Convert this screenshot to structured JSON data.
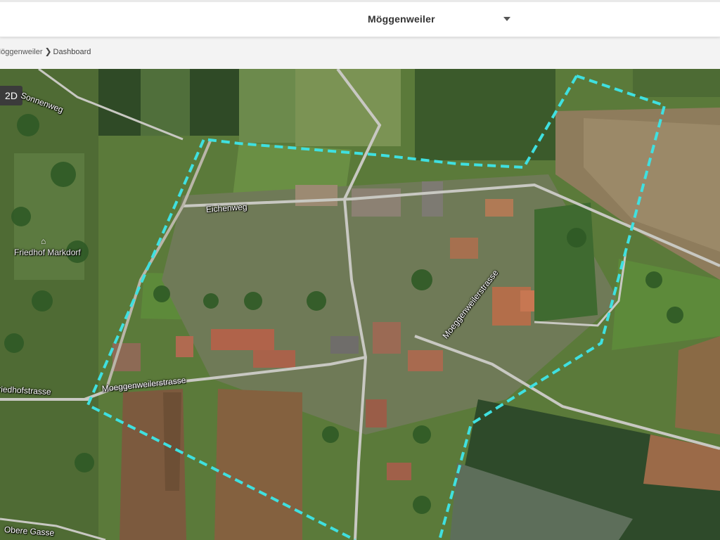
{
  "header": {
    "location_selector": {
      "value": "Möggenweiler"
    }
  },
  "breadcrumb": {
    "items": [
      "Möggenweiler",
      "Dashboard"
    ],
    "separator": "❯"
  },
  "map": {
    "view_toggle_label": "2D",
    "boundary_color": "#3fe0e0",
    "labels": {
      "eichenweg": "Eichenweg",
      "moeggenweilerstrasse": "Moeggenweilerstrasse",
      "moeggenweilerstrasse_vertical": "Moeggenweilerstrasse",
      "friedhofstrasse": "Friedhofstrasse",
      "erweg": "Sonnenweg",
      "obere": "Obere Gasse",
      "cemetery": "Friedhof Markdorf"
    }
  }
}
